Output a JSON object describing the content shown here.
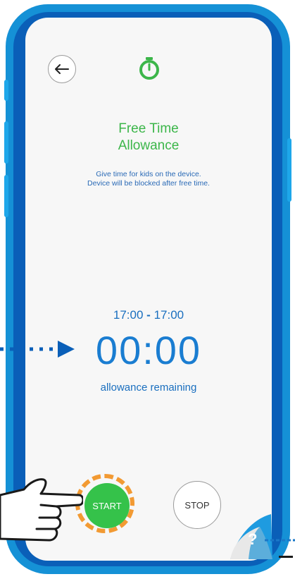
{
  "header": {
    "back_icon": "arrow-left-icon",
    "timer_icon": "stopwatch-icon"
  },
  "title": {
    "line1": "Free Time",
    "line2": "Allowance"
  },
  "description": {
    "line1": "Give time for kids on the device.",
    "line2": "Device will be blocked after free time."
  },
  "timer": {
    "range_start": "17:00",
    "range_separator": "-",
    "range_end": "17:00",
    "countdown": "00:00",
    "caption": "allowance remaining"
  },
  "controls": {
    "start_label": "START",
    "stop_label": "STOP"
  },
  "help": {
    "label": "?"
  },
  "colors": {
    "accent_green": "#35c24a",
    "title_green": "#3cb64a",
    "blue_text": "#1a7dd1",
    "highlight_orange": "#f29a33",
    "device_blue": "#1591d6"
  }
}
